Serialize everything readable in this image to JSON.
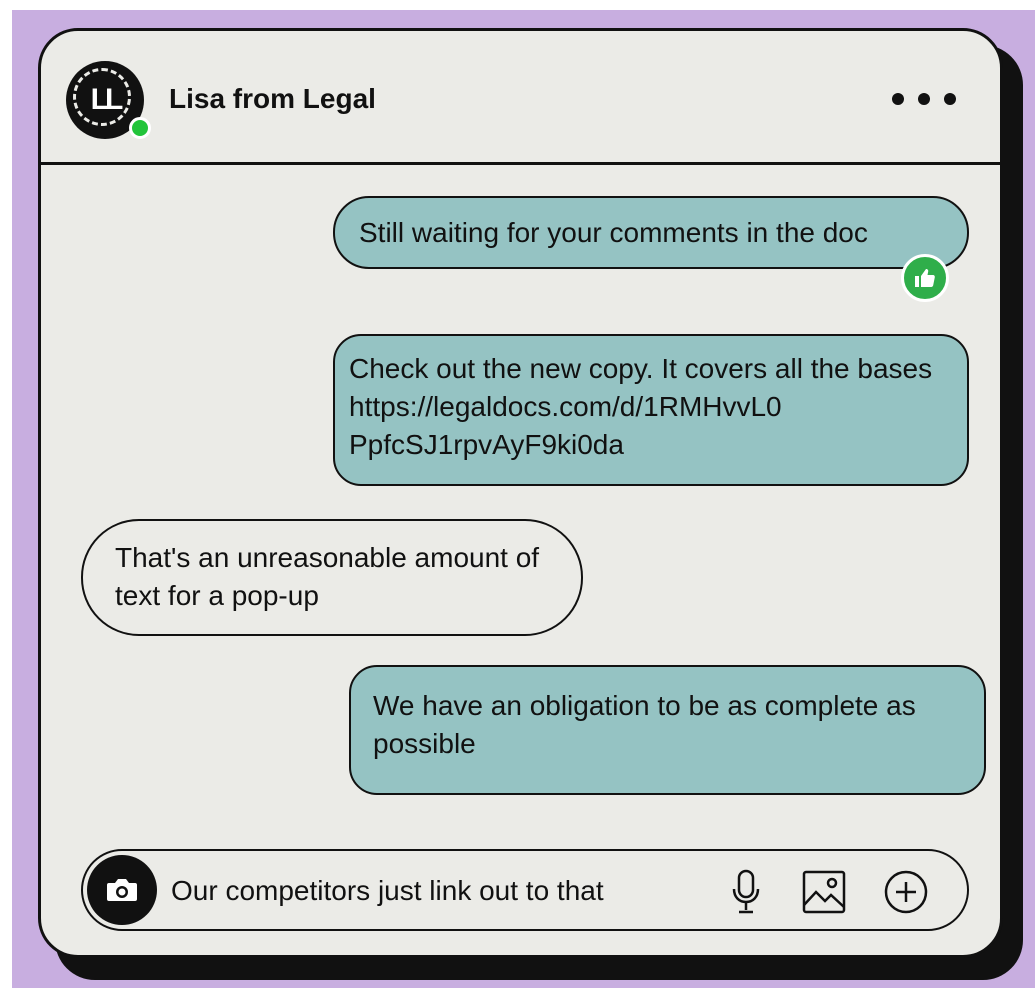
{
  "header": {
    "avatar_initials": "LL",
    "contact_name": "Lisa from Legal",
    "status": "online",
    "more_icon": "ellipsis-icon"
  },
  "messages": [
    {
      "direction": "sent",
      "text": "Still waiting for your comments in the doc",
      "reaction": "thumbs-up-icon"
    },
    {
      "direction": "sent",
      "text": "Check out the new copy. It covers all the bases https://legaldocs.com/d/1RMHvvL0 PpfcSJ1rpvAyF9ki0da"
    },
    {
      "direction": "received",
      "text": "That's an unreasonable amount of text for a pop-up"
    },
    {
      "direction": "sent",
      "text": "We have an obligation to be as complete as possible"
    }
  ],
  "composer": {
    "value": "Our competitors just link out to that",
    "icons": [
      "camera-icon",
      "microphone-icon",
      "image-icon",
      "plus-circle-icon"
    ]
  },
  "colors": {
    "background": "#c8aee0",
    "card": "#ebebe7",
    "sent_bubble": "#95c3c3",
    "online": "#22c43a",
    "reaction": "#2fae4a"
  }
}
